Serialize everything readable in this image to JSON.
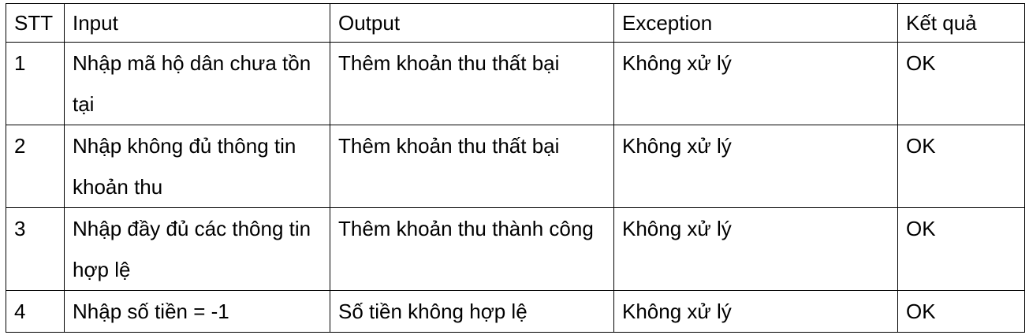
{
  "table": {
    "headers": [
      "STT",
      "Input",
      "Output",
      "Exception",
      "Kết quả"
    ],
    "rows": [
      [
        "1",
        "Nhập mã hộ dân chưa tồn tại",
        "Thêm khoản thu thất bại",
        "Không xử lý",
        "OK"
      ],
      [
        "2",
        "Nhập không đủ thông tin khoản thu",
        "Thêm khoản thu thất bại",
        "Không xử lý",
        "OK"
      ],
      [
        "3",
        "Nhập đầy đủ các thông tin hợp lệ",
        "Thêm khoản thu thành công",
        "Không xử lý",
        "OK"
      ],
      [
        "4",
        "Nhập số tiền = -1",
        "Số tiền không hợp lệ",
        "Không xử lý",
        "OK"
      ]
    ]
  }
}
